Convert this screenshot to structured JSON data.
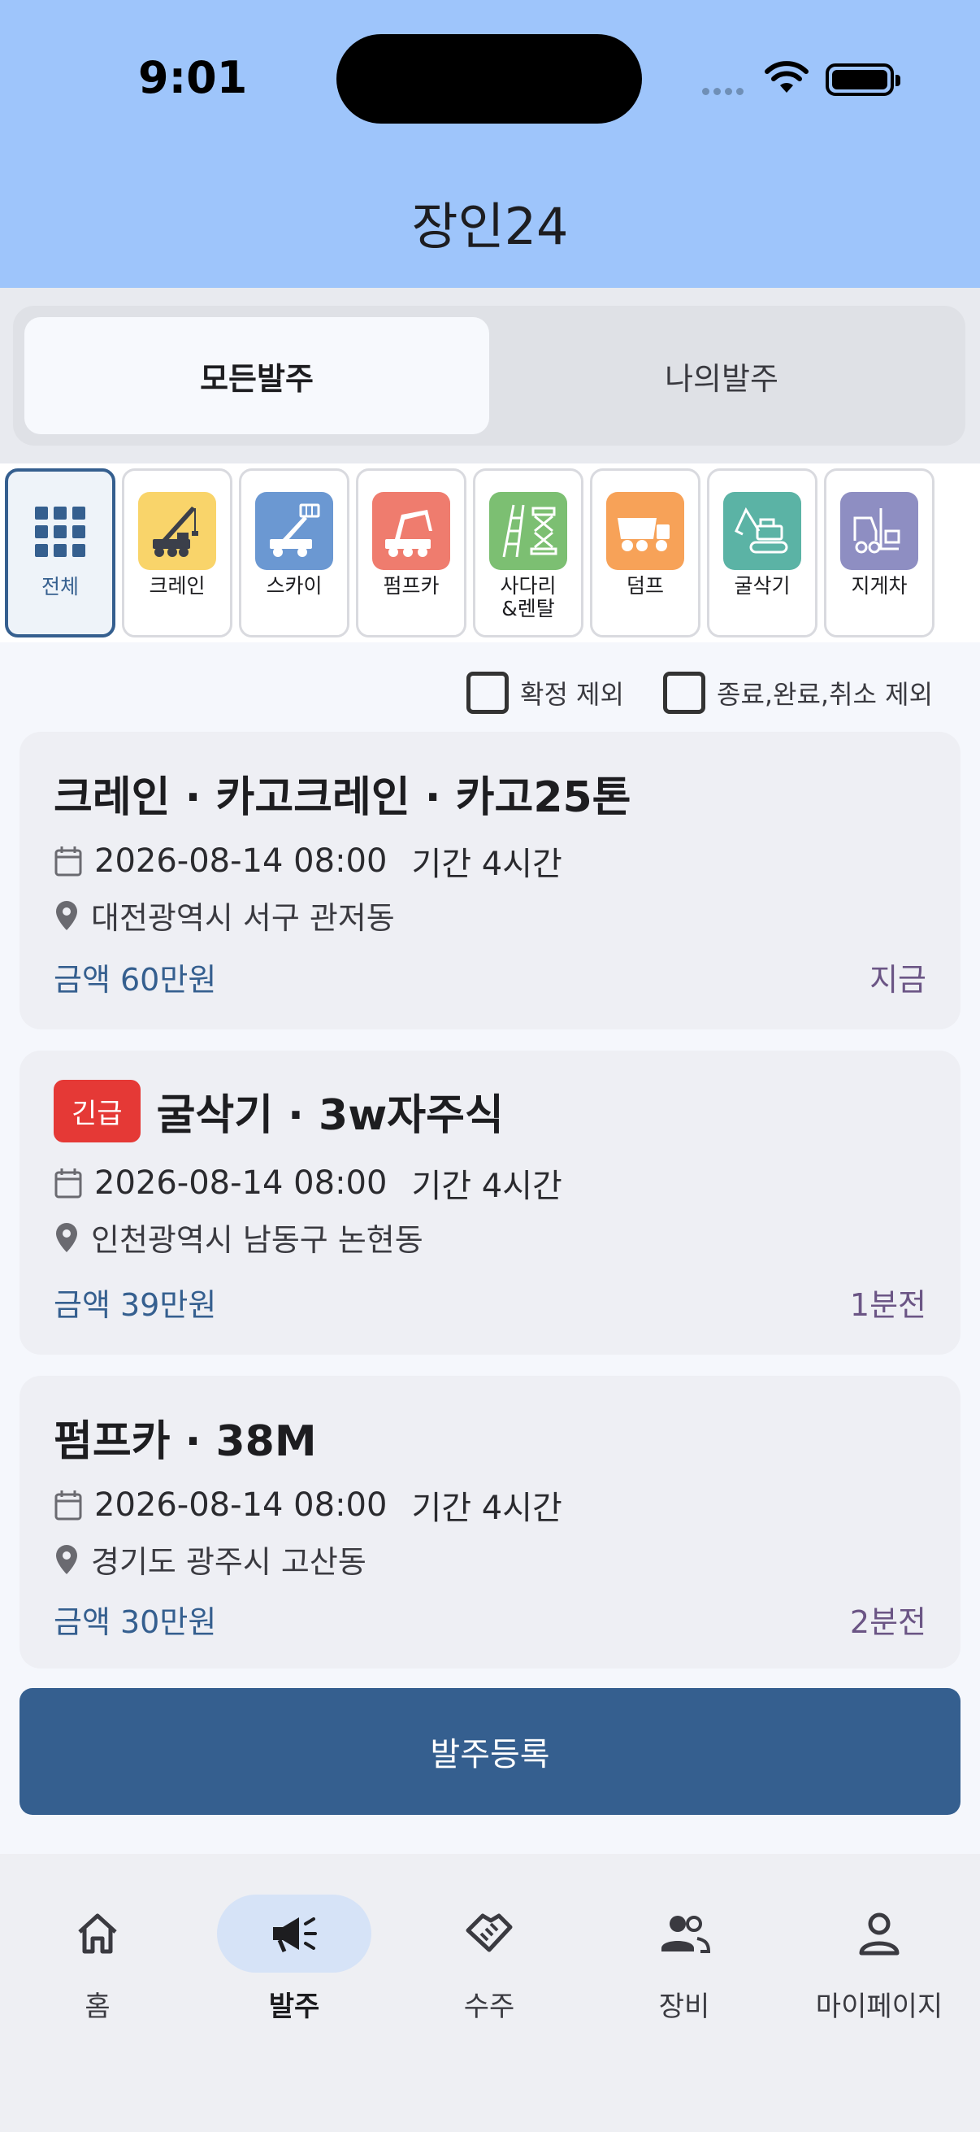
{
  "status_bar": {
    "time": "9:01"
  },
  "app": {
    "title": "장인24"
  },
  "segments": {
    "all": "모든발주",
    "mine": "나의발주"
  },
  "categories": [
    {
      "label": "전체",
      "icon": "grid-icon",
      "color": "#355f8f"
    },
    {
      "label": "크레인",
      "icon": "crane-icon",
      "color": "#f9d46a"
    },
    {
      "label": "스카이",
      "icon": "sky-lift-icon",
      "color": "#6b98d2"
    },
    {
      "label": "펌프카",
      "icon": "pump-truck-icon",
      "color": "#ef7c6e"
    },
    {
      "label": "사다리\n&렌탈",
      "icon": "ladder-icon",
      "color": "#7cbf72"
    },
    {
      "label": "덤프",
      "icon": "dump-truck-icon",
      "color": "#f7a258"
    },
    {
      "label": "굴삭기",
      "icon": "excavator-icon",
      "color": "#5bb3a5"
    },
    {
      "label": "지게차",
      "icon": "forklift-icon",
      "color": "#8e8ec2"
    }
  ],
  "filters": {
    "exclude_confirmed": "확정 제외",
    "exclude_done": "종료,완료,취소 제외"
  },
  "orders": [
    {
      "urgent": "",
      "title": "크레인 · 카고크레인 · 카고25톤",
      "datetime": "2026-08-14 08:00",
      "duration": "기간 4시간",
      "location": "대전광역시 서구 관저동",
      "price": "금액 60만원",
      "ago": "지금"
    },
    {
      "urgent": "긴급",
      "title": "굴삭기 · 3w자주식",
      "datetime": "2026-08-14 08:00",
      "duration": "기간 4시간",
      "location": "인천광역시 남동구 논현동",
      "price": "금액 39만원",
      "ago": "1분전"
    },
    {
      "urgent": "",
      "title": "펌프카 · 38M",
      "datetime": "2026-08-14 08:00",
      "duration": "기간 4시간",
      "location": "경기도 광주시 고산동",
      "price": "금액 30만원",
      "ago": "2분전"
    }
  ],
  "register_button": "발주등록",
  "tabs": [
    {
      "label": "홈",
      "icon": "home-icon"
    },
    {
      "label": "발주",
      "icon": "megaphone-icon"
    },
    {
      "label": "수주",
      "icon": "handshake-icon"
    },
    {
      "label": "장비",
      "icon": "people-icon"
    },
    {
      "label": "마이페이지",
      "icon": "person-icon"
    }
  ]
}
